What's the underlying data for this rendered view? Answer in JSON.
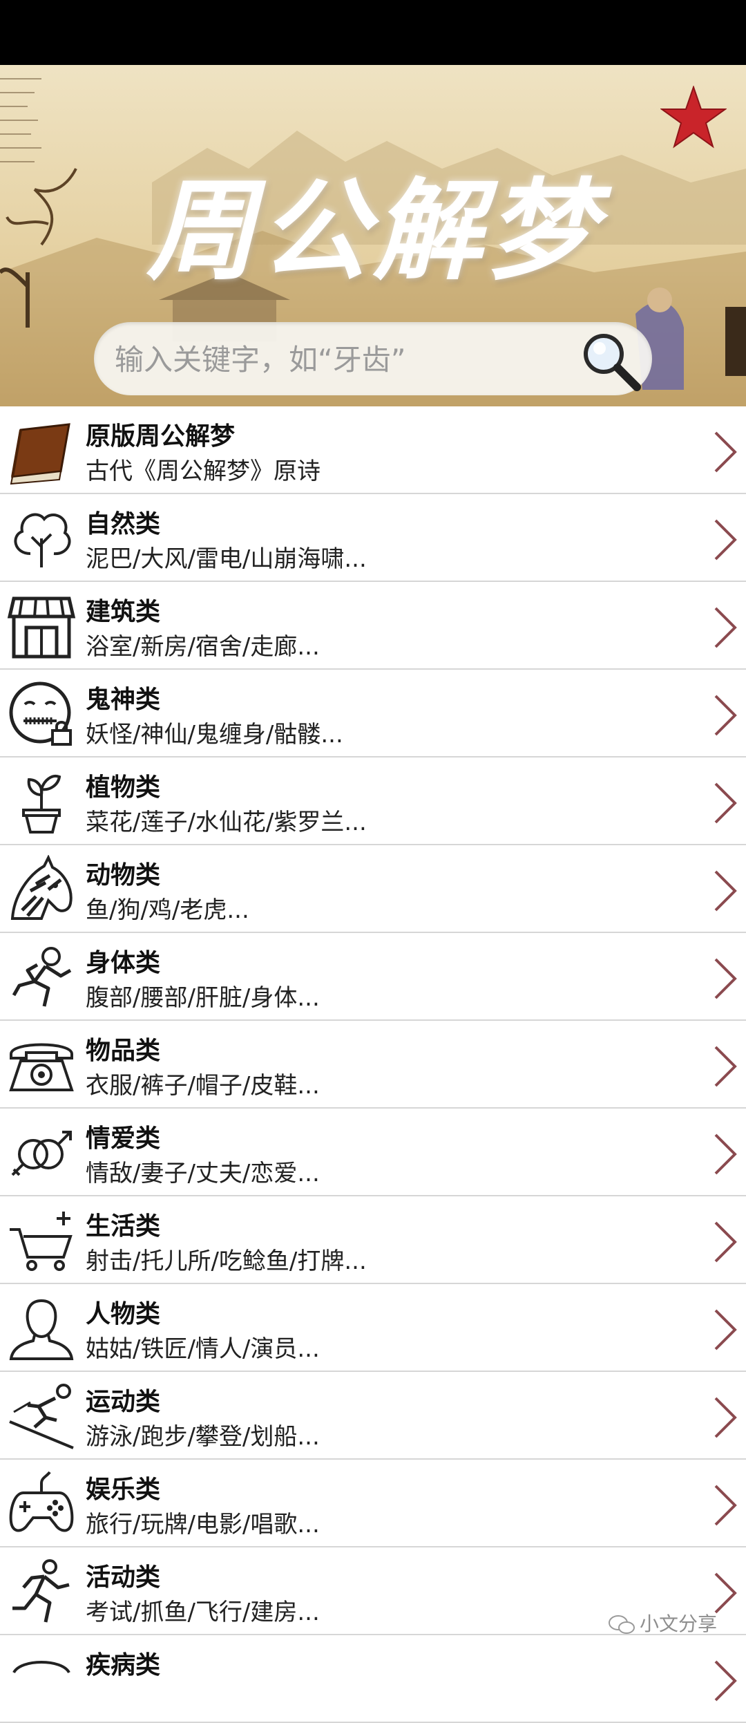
{
  "banner": {
    "title": "周公解梦",
    "favorite_icon": "star-icon",
    "star_color": "#c9242a"
  },
  "search": {
    "placeholder": "输入关键字，如“牙齿”",
    "icon": "search-icon"
  },
  "categories": [
    {
      "title": "原版周公解梦",
      "subtitle": "古代《周公解梦》原诗",
      "icon": "book-icon"
    },
    {
      "title": "自然类",
      "subtitle": "泥巴/大风/雷电/山崩海啸...",
      "icon": "tree-icon"
    },
    {
      "title": "建筑类",
      "subtitle": "浴室/新房/宿舍/走廊...",
      "icon": "storefront-icon"
    },
    {
      "title": "鬼神类",
      "subtitle": "妖怪/神仙/鬼缠身/骷髅...",
      "icon": "zipper-face-icon"
    },
    {
      "title": "植物类",
      "subtitle": "菜花/莲子/水仙花/紫罗兰...",
      "icon": "potted-plant-icon"
    },
    {
      "title": "动物类",
      "subtitle": "鱼/狗/鸡/老虎...",
      "icon": "zebra-icon"
    },
    {
      "title": "身体类",
      "subtitle": "腹部/腰部/肝脏/身体...",
      "icon": "running-figure-icon"
    },
    {
      "title": "物品类",
      "subtitle": "衣服/裤子/帽子/皮鞋...",
      "icon": "telephone-icon"
    },
    {
      "title": "情爱类",
      "subtitle": "情敌/妻子/丈夫/恋爱...",
      "icon": "gender-symbols-icon"
    },
    {
      "title": "生活类",
      "subtitle": "射击/托儿所/吃鲶鱼/打牌...",
      "icon": "shopping-cart-add-icon"
    },
    {
      "title": "人物类",
      "subtitle": "姑姑/铁匠/情人/演员...",
      "icon": "person-icon"
    },
    {
      "title": "运动类",
      "subtitle": "游泳/跑步/攀登/划船...",
      "icon": "skiing-icon"
    },
    {
      "title": "娱乐类",
      "subtitle": "旅行/玩牌/电影/唱歌...",
      "icon": "gamepad-icon"
    },
    {
      "title": "活动类",
      "subtitle": "考试/抓鱼/飞行/建房...",
      "icon": "running-icon"
    },
    {
      "title": "疾病类",
      "subtitle": "",
      "icon": "partial-icon"
    }
  ],
  "watermark": {
    "text": "小文分享",
    "icon": "wechat-icon"
  },
  "colors": {
    "divider": "#d6d6d6",
    "chevron": "#8b4a4f",
    "status_bar": "#000000"
  }
}
